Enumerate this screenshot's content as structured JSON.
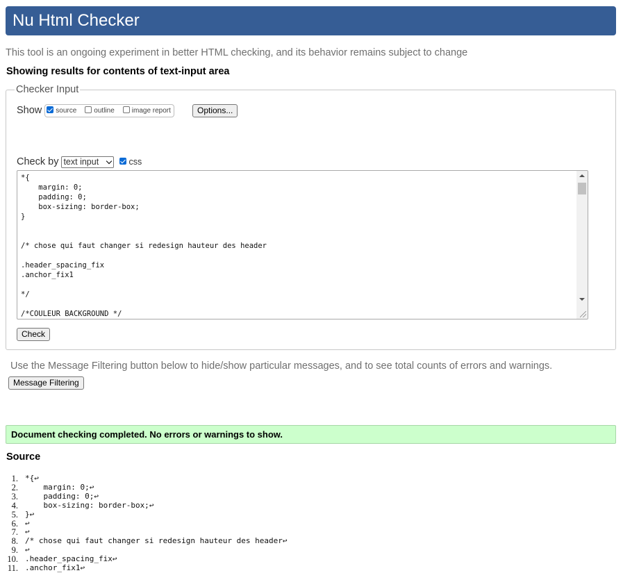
{
  "header": {
    "title": "Nu Html Checker"
  },
  "intro": "This tool is an ongoing experiment in better HTML checking, and its behavior remains subject to change",
  "showing": "Showing results for contents of text-input area",
  "checker": {
    "legend": "Checker Input",
    "show_label": "Show",
    "show_options": [
      {
        "label": "source",
        "checked": true
      },
      {
        "label": "outline",
        "checked": false
      },
      {
        "label": "image report",
        "checked": false
      }
    ],
    "options_button": "Options...",
    "check_by_label": "Check by",
    "check_by_value": "text input",
    "css_label": "css",
    "css_checked": true,
    "textarea_content": "*{\n    margin: 0;\n    padding: 0;\n    box-sizing: border-box;\n}\n\n\n/* chose qui faut changer si redesign hauteur des header\n\n.header_spacing_fix\n.anchor_fix1\n\n*/\n\n/*COULEUR BACKGROUND */",
    "check_button": "Check"
  },
  "filter": {
    "text": "Use the Message Filtering button below to hide/show particular messages, and to see total counts of errors and warnings.",
    "button": "Message Filtering"
  },
  "result": {
    "message": "Document checking completed. No errors or warnings to show."
  },
  "source": {
    "heading": "Source",
    "lines": [
      {
        "n": "1.",
        "code": "*{"
      },
      {
        "n": "2.",
        "code": "    margin: 0;"
      },
      {
        "n": "3.",
        "code": "    padding: 0;"
      },
      {
        "n": "4.",
        "code": "    box-sizing: border-box;"
      },
      {
        "n": "5.",
        "code": "}"
      },
      {
        "n": "6.",
        "code": ""
      },
      {
        "n": "7.",
        "code": ""
      },
      {
        "n": "8.",
        "code": "/* chose qui faut changer si redesign hauteur des header"
      },
      {
        "n": "9.",
        "code": ""
      },
      {
        "n": "10.",
        "code": ".header_spacing_fix"
      },
      {
        "n": "11.",
        "code": ".anchor_fix1"
      }
    ],
    "line_end_glyph": "↩"
  }
}
